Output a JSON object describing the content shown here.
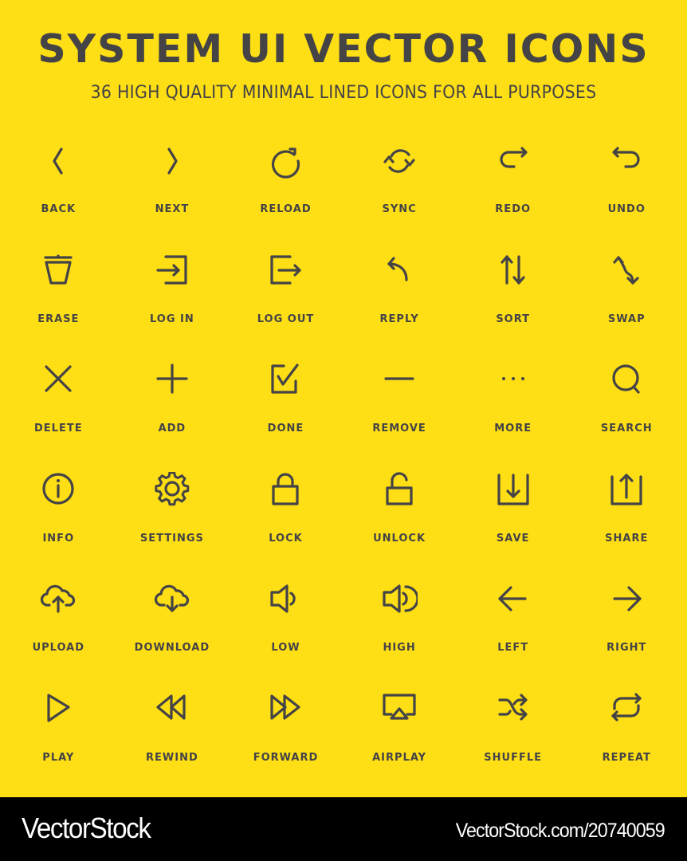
{
  "header": {
    "title": "SYSTEM UI VECTOR ICONS",
    "subtitle": "36 HIGH QUALITY MINIMAL LINED ICONS FOR ALL PURPOSES"
  },
  "colors": {
    "background": "#FEDE14",
    "ink": "#444346",
    "footer_bg": "#000000",
    "footer_text": "#FFFFFF"
  },
  "icons": [
    {
      "label": "BACK",
      "icon": "chevron-left-icon"
    },
    {
      "label": "NEXT",
      "icon": "chevron-right-icon"
    },
    {
      "label": "RELOAD",
      "icon": "reload-icon"
    },
    {
      "label": "SYNC",
      "icon": "sync-icon"
    },
    {
      "label": "REDO",
      "icon": "redo-icon"
    },
    {
      "label": "UNDO",
      "icon": "undo-icon"
    },
    {
      "label": "ERASE",
      "icon": "trash-icon"
    },
    {
      "label": "LOG IN",
      "icon": "log-in-icon"
    },
    {
      "label": "LOG OUT",
      "icon": "log-out-icon"
    },
    {
      "label": "REPLY",
      "icon": "reply-icon"
    },
    {
      "label": "SORT",
      "icon": "sort-icon"
    },
    {
      "label": "SWAP",
      "icon": "swap-icon"
    },
    {
      "label": "DELETE",
      "icon": "close-icon"
    },
    {
      "label": "ADD",
      "icon": "plus-icon"
    },
    {
      "label": "DONE",
      "icon": "checkbox-icon"
    },
    {
      "label": "REMOVE",
      "icon": "minus-icon"
    },
    {
      "label": "MORE",
      "icon": "ellipsis-icon"
    },
    {
      "label": "SEARCH",
      "icon": "search-icon"
    },
    {
      "label": "INFO",
      "icon": "info-icon"
    },
    {
      "label": "SETTINGS",
      "icon": "gear-icon"
    },
    {
      "label": "LOCK",
      "icon": "lock-icon"
    },
    {
      "label": "UNLOCK",
      "icon": "unlock-icon"
    },
    {
      "label": "SAVE",
      "icon": "save-icon"
    },
    {
      "label": "SHARE",
      "icon": "share-icon"
    },
    {
      "label": "UPLOAD",
      "icon": "cloud-upload-icon"
    },
    {
      "label": "DOWNLOAD",
      "icon": "cloud-download-icon"
    },
    {
      "label": "LOW",
      "icon": "volume-low-icon"
    },
    {
      "label": "HIGH",
      "icon": "volume-high-icon"
    },
    {
      "label": "LEFT",
      "icon": "arrow-left-icon"
    },
    {
      "label": "RIGHT",
      "icon": "arrow-right-icon"
    },
    {
      "label": "PLAY",
      "icon": "play-icon"
    },
    {
      "label": "REWIND",
      "icon": "rewind-icon"
    },
    {
      "label": "FORWARD",
      "icon": "fast-forward-icon"
    },
    {
      "label": "AIRPLAY",
      "icon": "airplay-icon"
    },
    {
      "label": "SHUFFLE",
      "icon": "shuffle-icon"
    },
    {
      "label": "REPEAT",
      "icon": "repeat-icon"
    }
  ],
  "footer": {
    "brand": "VectorStock",
    "reference": "VectorStock.com/20740059"
  }
}
